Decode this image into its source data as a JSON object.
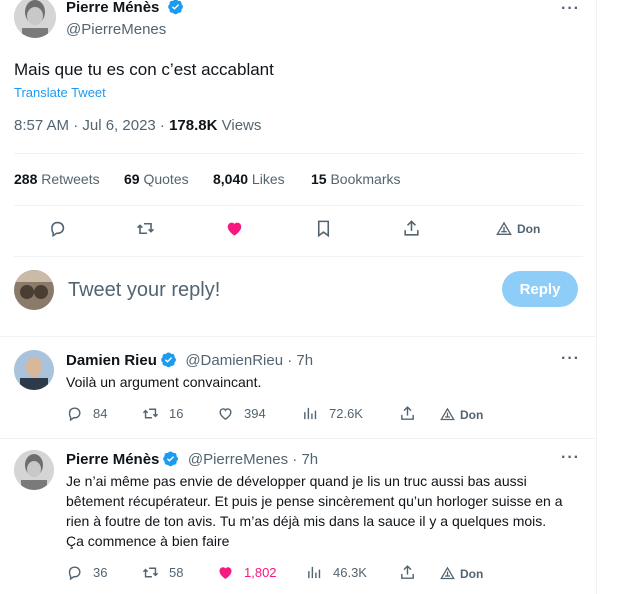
{
  "main_tweet": {
    "author_name": "Pierre Ménès",
    "author_handle": "@PierreMenes",
    "text": "Mais que tu es con c’est accablant",
    "translate_label": "Translate Tweet",
    "time": "8:57 AM · Jul 6, 2023 · ",
    "views_count": "178.8K",
    "views_label": " Views",
    "stats": [
      {
        "num": "288",
        "label": " Retweets"
      },
      {
        "num": "69",
        "label": " Quotes"
      },
      {
        "num": "8,040",
        "label": " Likes"
      },
      {
        "num": "15",
        "label": " Bookmarks"
      }
    ],
    "don_label": "Don",
    "liked_color": "#f91880"
  },
  "composer": {
    "placeholder": "Tweet your reply!",
    "reply_label": "Reply"
  },
  "replies": [
    {
      "author_name": "Damien Rieu",
      "author_handle": "@DamienRieu",
      "time": " · 7h",
      "text": "Voilà un argument convaincant.",
      "replies": "84",
      "retweets": "16",
      "likes": "394",
      "views": "72.6K",
      "don_label": "Don"
    },
    {
      "author_name": "Pierre Ménès",
      "author_handle": "@PierreMenes",
      "time": " · 7h",
      "text": "Je n’ai même pas envie de développer quand je lis un truc aussi bas aussi bêtement récupérateur. Et puis je pense sincèrement qu’un horloger suisse en a rien à foutre de ton avis. Tu m’as déjà mis dans la sauce il y a quelques mois. Ça commence à bien faire",
      "replies": "36",
      "retweets": "58",
      "likes": "1,802",
      "views": "46.3K",
      "don_label": "Don"
    }
  ],
  "colors": {
    "accent": "#1d9bf0",
    "muted": "#536471",
    "like": "#f91880"
  }
}
